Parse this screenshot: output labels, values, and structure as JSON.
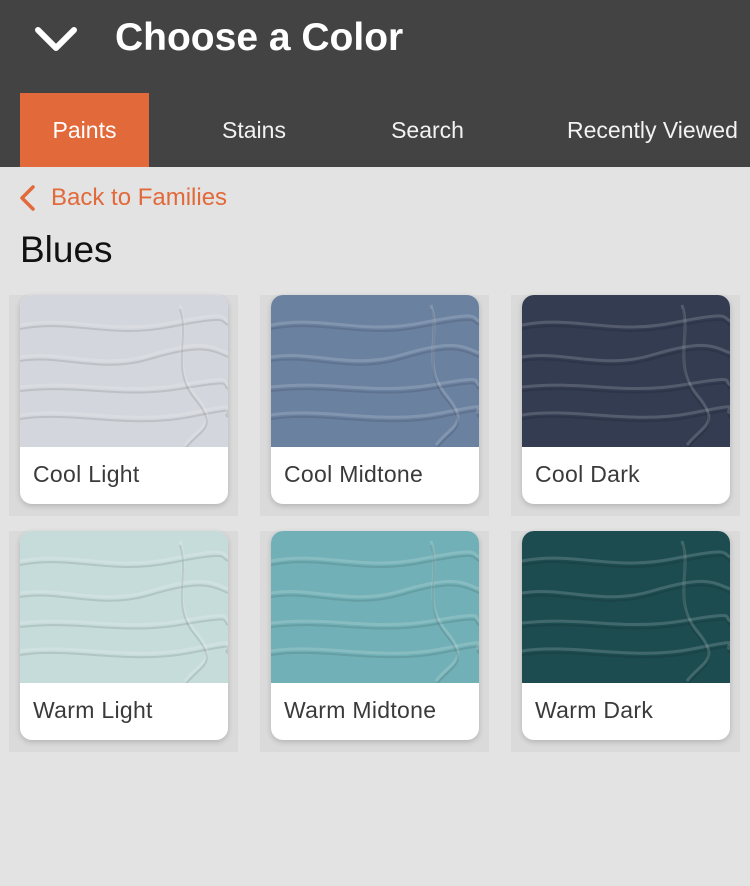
{
  "header": {
    "title": "Choose a Color",
    "collapse_icon": "chevron-down-icon"
  },
  "tabs": [
    {
      "label": "Paints",
      "active": true
    },
    {
      "label": "Stains",
      "active": false
    },
    {
      "label": "Search",
      "active": false
    },
    {
      "label": "Recently Viewed",
      "active": false
    }
  ],
  "nav": {
    "back_label": "Back to Families",
    "back_icon": "chevron-left-icon"
  },
  "family": {
    "name": "Blues"
  },
  "swatches": [
    {
      "label": "Cool Light",
      "color": "#d3d6dc"
    },
    {
      "label": "Cool Midtone",
      "color": "#6a81a0"
    },
    {
      "label": "Cool Dark",
      "color": "#333c51"
    },
    {
      "label": "Warm Light",
      "color": "#c6dcda"
    },
    {
      "label": "Warm Midtone",
      "color": "#71b0b6"
    },
    {
      "label": "Warm Dark",
      "color": "#1d4c50"
    }
  ],
  "colors": {
    "accent": "#e2693a",
    "header_bg": "#434343",
    "page_bg": "#e3e3e3"
  }
}
